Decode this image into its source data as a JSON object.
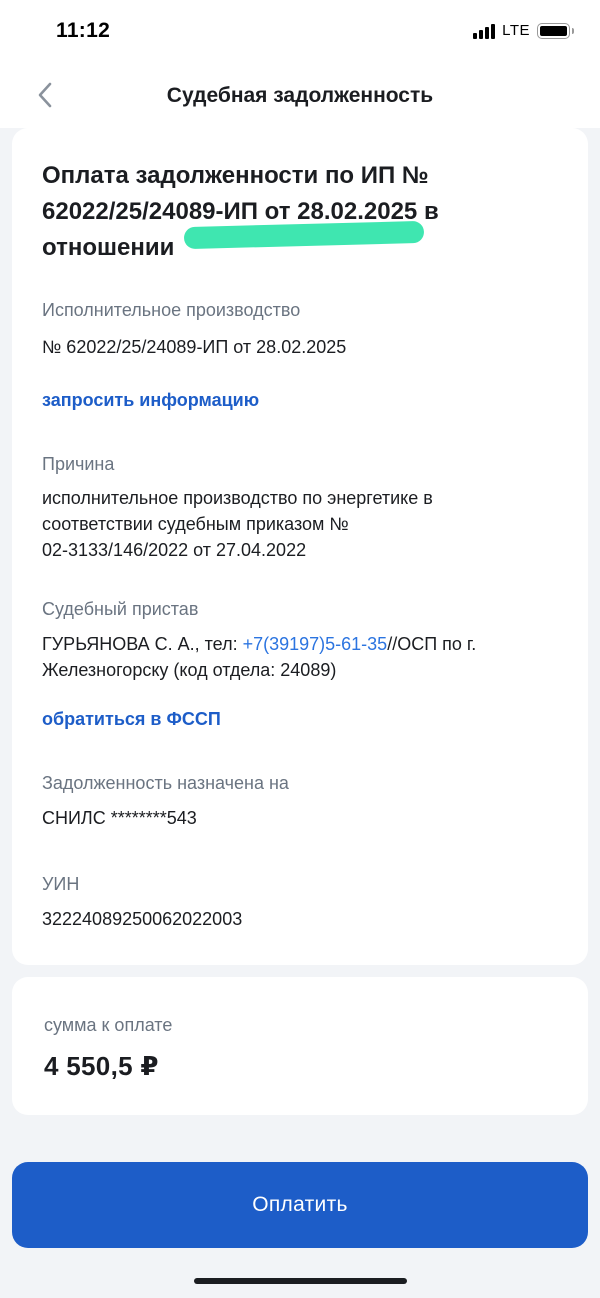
{
  "status_bar": {
    "time": "11:12",
    "network": "LTE",
    "icons": [
      "signal-icon",
      "battery-icon"
    ]
  },
  "nav": {
    "back_icon": "chevron-left-icon",
    "title": "Судебная задолженность"
  },
  "details": {
    "heading_line1": "Оплата задолженности по ИП №",
    "heading_line2": "62022/25/24089-ИП от 28.02.2025 в",
    "heading_line3": "отношении",
    "enforcement": {
      "label": "Исполнительное производство",
      "value": "№ 62022/25/24089-ИП от 28.02.2025"
    },
    "request_info_link": "запросить информацию",
    "reason": {
      "label": "Причина",
      "value_line1": "исполнительное производство по энергетике в",
      "value_line2": "соответствии судебным приказом №",
      "value_line3": "02-3133/146/2022 от 27.04.2022"
    },
    "bailiff": {
      "label": "Судебный пристав",
      "name_prefix": "ГУРЬЯНОВА С. А., тел: ",
      "phone": "+7(39197)5-61-35",
      "suffix_line1": "//ОСП по г.",
      "line2": "Железногорску (код отдела: 24089)"
    },
    "contact_link": "обратиться в ФССП",
    "assigned_to": {
      "label": "Задолженность назначена на",
      "value": "СНИЛС ********543"
    },
    "uin": {
      "label": "УИН",
      "value": "32224089250062022003"
    }
  },
  "payment": {
    "sum_label": "сумма к оплате",
    "sum_value": "4 550,5 ₽",
    "pay_button": "Оплатить"
  },
  "colors": {
    "accent": "#1d5dc8",
    "phone_link": "#2b74e0",
    "redaction": "#3fe6b0",
    "background": "#f2f4f7"
  }
}
